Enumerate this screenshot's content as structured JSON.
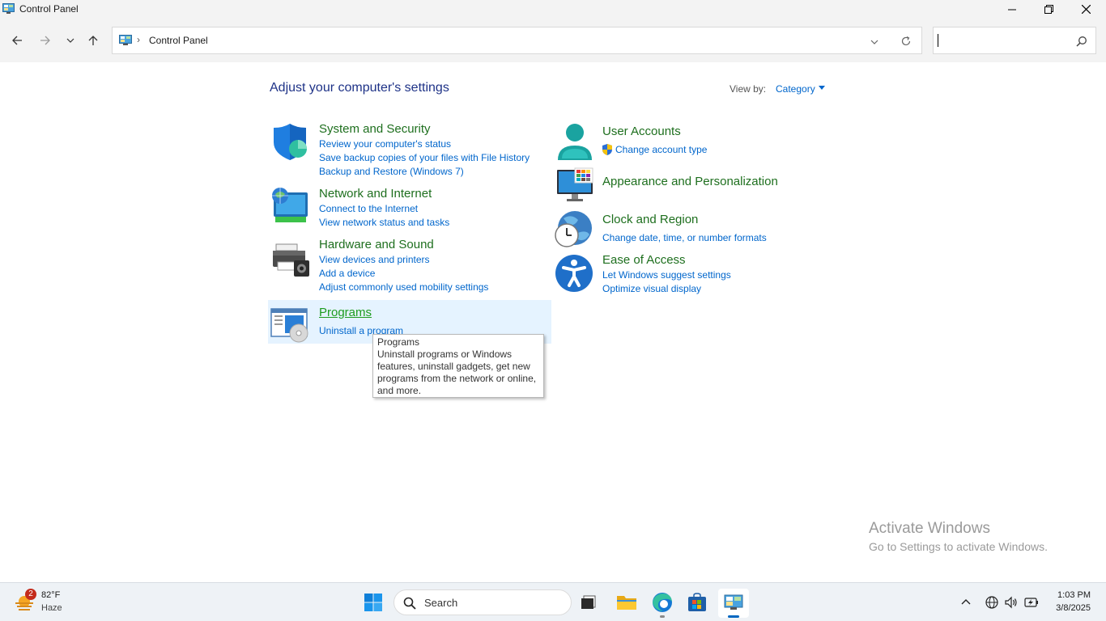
{
  "window": {
    "title": "Control Panel"
  },
  "nav": {
    "breadcrumb": "Control Panel",
    "breadcrumb_separator": "›",
    "search_placeholder": ""
  },
  "main": {
    "heading": "Adjust your computer's settings",
    "view_by_label": "View by:",
    "view_by_value": "Category",
    "categories_left": [
      {
        "title": "System and Security",
        "icon": "shield-icon",
        "links": [
          "Review your computer's status",
          "Save backup copies of your files with File History",
          "Backup and Restore (Windows 7)"
        ]
      },
      {
        "title": "Network and Internet",
        "icon": "network-globe-icon",
        "links": [
          "Connect to the Internet",
          "View network status and tasks"
        ]
      },
      {
        "title": "Hardware and Sound",
        "icon": "printer-speaker-icon",
        "links": [
          "View devices and printers",
          "Add a device",
          "Adjust commonly used mobility settings"
        ]
      },
      {
        "title": "Programs",
        "icon": "programs-icon",
        "links": [
          "Uninstall a program"
        ]
      }
    ],
    "categories_right": [
      {
        "title": "User Accounts",
        "icon": "user-icon",
        "links": [
          "Change account type"
        ]
      },
      {
        "title": "Appearance and Personalization",
        "icon": "monitor-palette-icon",
        "links": []
      },
      {
        "title": "Clock and Region",
        "icon": "clock-globe-icon",
        "links": [
          "Change date, time, or number formats"
        ]
      },
      {
        "title": "Ease of Access",
        "icon": "accessibility-icon",
        "links": [
          "Let Windows suggest settings",
          "Optimize visual display"
        ]
      }
    ],
    "tooltip": {
      "title": "Programs",
      "lines": [
        "Uninstall programs or Windows",
        "features, uninstall gadgets, get new",
        "programs from the network or online,",
        "and more."
      ]
    }
  },
  "watermark": {
    "line1": "Activate Windows",
    "line2": "Go to Settings to activate Windows."
  },
  "taskbar": {
    "weather_badge": "2",
    "temperature": "82°F",
    "condition": "Haze",
    "search_label": "Search",
    "time": "1:03 PM",
    "date": "3/8/2025"
  },
  "colors": {
    "category_title": "#1e6f1e",
    "link": "#0066cc",
    "heading": "#1e3287",
    "hover_bg": "#e5f3ff"
  }
}
